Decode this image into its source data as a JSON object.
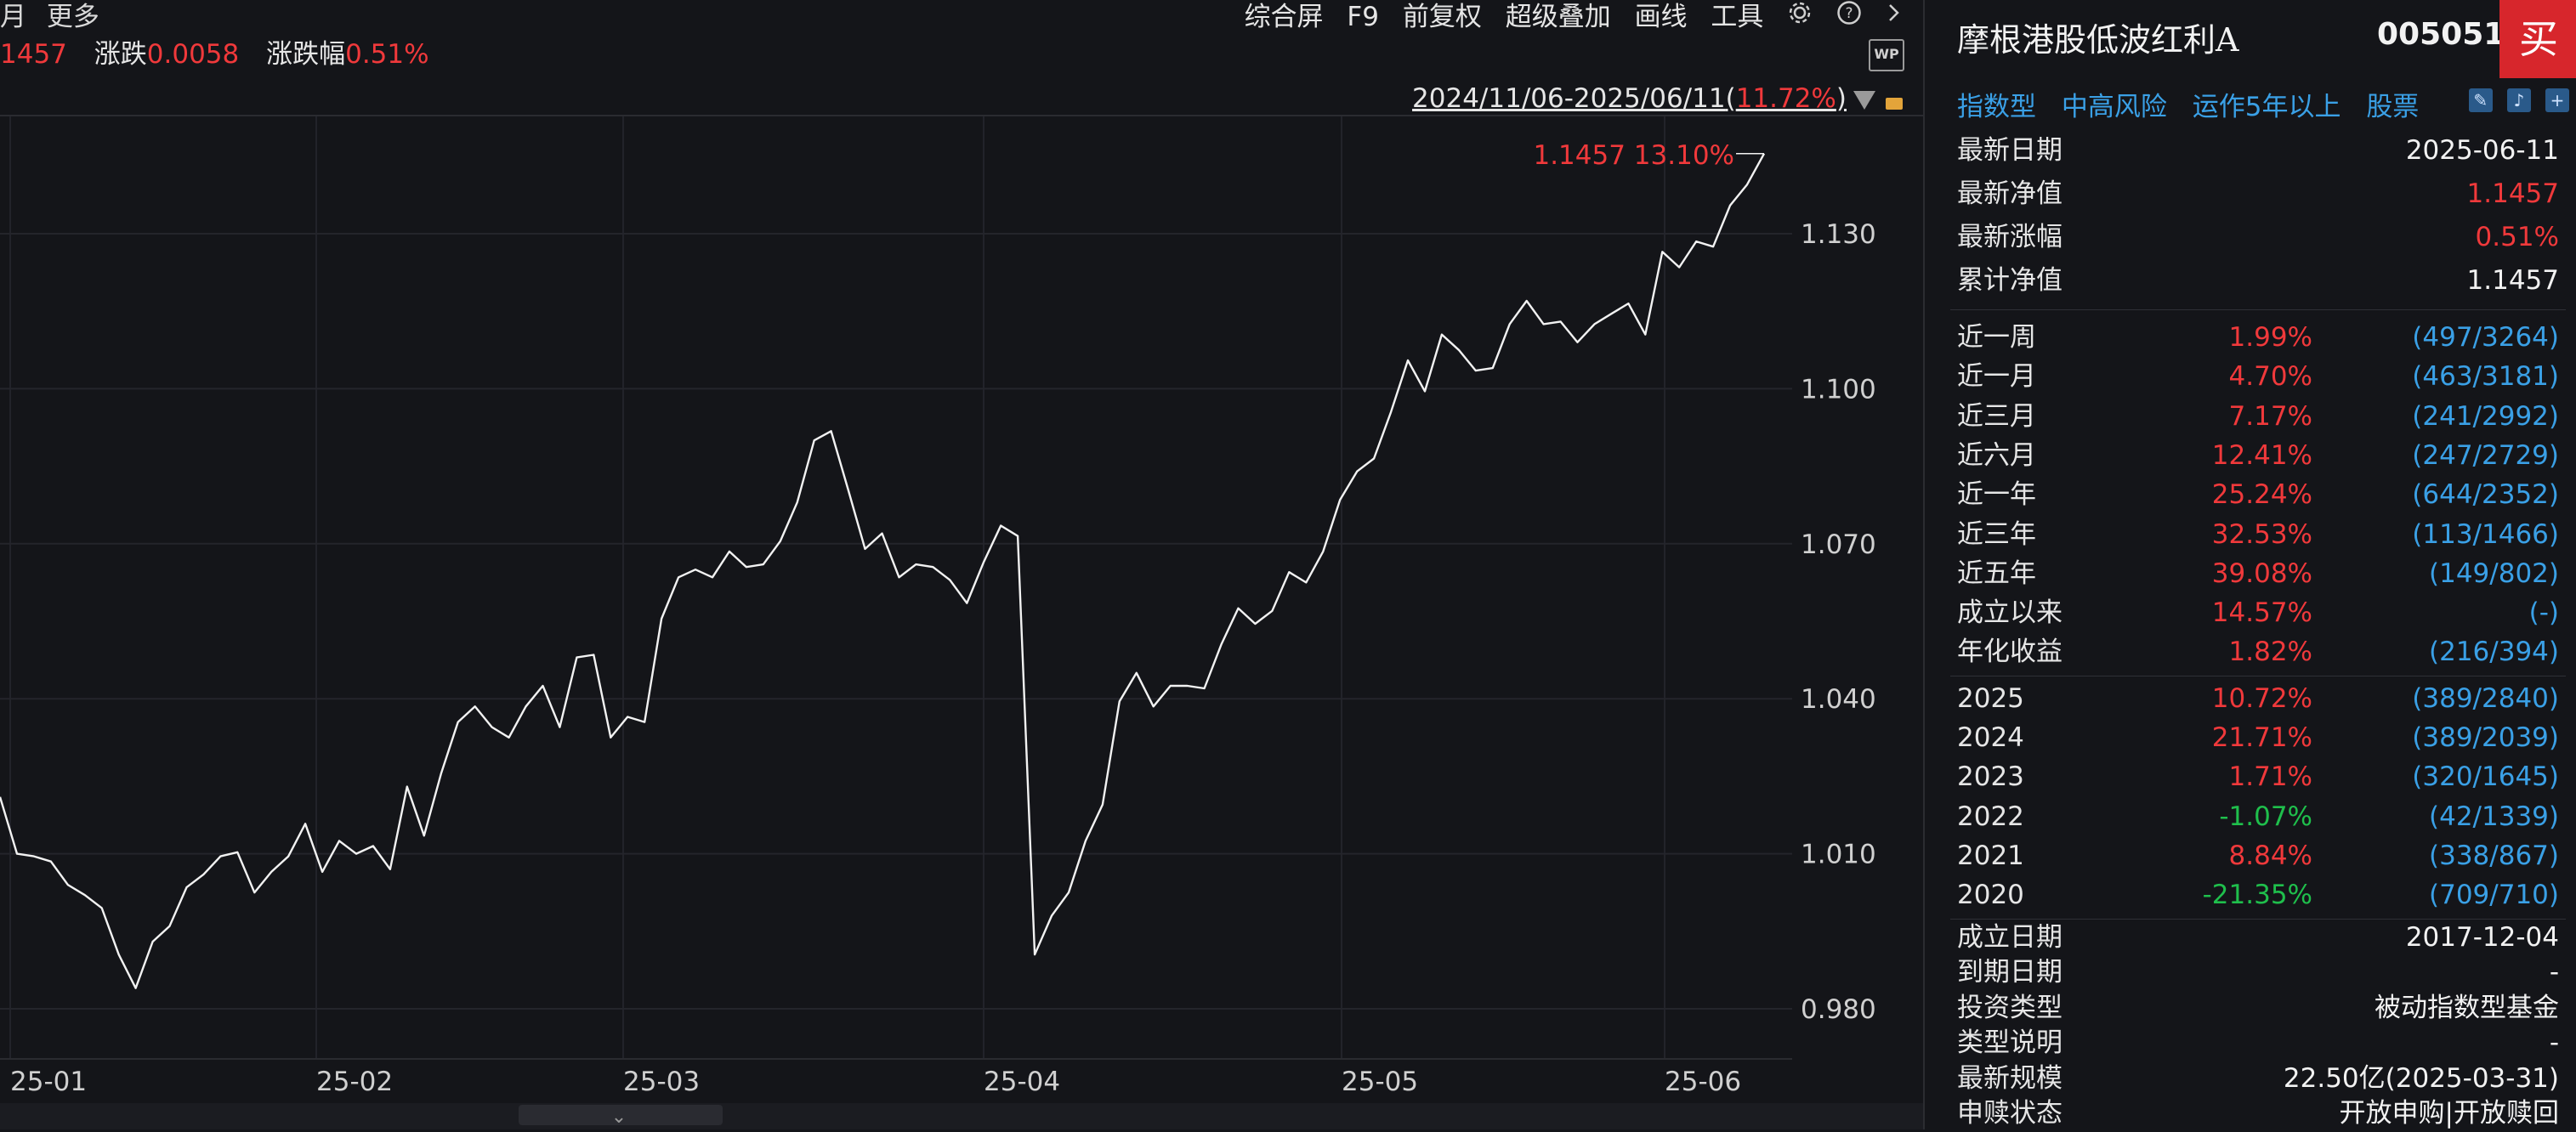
{
  "toolbar": {
    "left": [
      "月",
      "更多"
    ],
    "right": [
      "综合屏",
      "F9",
      "前复权",
      "超级叠加",
      "画线",
      "工具"
    ],
    "settings_icon": "gear-icon",
    "help_icon": "help-icon",
    "next_icon": "chevron-right-icon"
  },
  "quote": {
    "nav_fragment": "1457",
    "change_label": "涨跌",
    "change_value": "0.0058",
    "pct_label": "涨跌幅",
    "pct_value": "0.51%"
  },
  "range": {
    "dates": "2024/11/06-2025/06/11",
    "open_paren": "(",
    "return": "11.72%",
    "close_paren": ")"
  },
  "wp_icon_text": "WP",
  "chart_data": {
    "type": "line",
    "y_ticks": [
      "1.130",
      "1.100",
      "1.070",
      "1.040",
      "1.010",
      "0.980"
    ],
    "y_tick_values": [
      1.13,
      1.1,
      1.07,
      1.04,
      1.01,
      0.98
    ],
    "x_ticks": [
      "25-01",
      "25-02",
      "25-03",
      "25-04",
      "25-05",
      "25-06"
    ],
    "last_label": "1.1457 13.10%",
    "grid": true,
    "series": [
      {
        "values": [
          1.021,
          1.01,
          1.0095,
          1.0085,
          1.004,
          1.002,
          0.9995,
          0.9905,
          0.984,
          0.993,
          0.996,
          1.0035,
          1.006,
          1.0095,
          1.0103,
          1.0025,
          1.0065,
          1.0095,
          1.0158,
          1.0065,
          1.0125,
          1.01,
          1.0115,
          1.007,
          1.023,
          1.0135,
          1.0255,
          1.0355,
          1.0385,
          1.0345,
          1.0325,
          1.0385,
          1.0425,
          1.0345,
          1.048,
          1.0485,
          1.0325,
          1.0365,
          1.0355,
          1.0555,
          1.0635,
          1.065,
          1.0635,
          1.0685,
          1.0655,
          1.066,
          1.0705,
          1.078,
          1.09,
          1.0918,
          1.0805,
          1.069,
          1.072,
          1.0635,
          1.066,
          1.0655,
          1.063,
          1.0585,
          1.0665,
          1.0735,
          1.0715,
          0.9905,
          0.998,
          1.0025,
          1.0125,
          1.0195,
          1.0395,
          1.045,
          1.0385,
          1.0425,
          1.0425,
          1.042,
          1.0505,
          1.0575,
          1.0545,
          1.057,
          1.0645,
          1.0625,
          1.0685,
          1.0785,
          1.084,
          1.0865,
          1.0955,
          1.1055,
          1.0995,
          1.1105,
          1.1075,
          1.1035,
          1.104,
          1.1125,
          1.117,
          1.1125,
          1.113,
          1.109,
          1.1125,
          1.1145,
          1.1165,
          1.1105,
          1.1265,
          1.1235,
          1.1285,
          1.1275,
          1.1355,
          1.1395,
          1.1455
        ]
      }
    ]
  },
  "side": {
    "name": "摩根港股低波红利A",
    "code": "005051",
    "buy": "买",
    "tags": [
      "指数型",
      "中高风险",
      "运作5年以上",
      "股票"
    ],
    "tag_icons": [
      "pencil-icon",
      "bell-icon",
      "plus-icon"
    ],
    "summary": [
      {
        "k": "最新日期",
        "v": "2025-06-11",
        "c": "white"
      },
      {
        "k": "最新净值",
        "v": "1.1457",
        "c": "red"
      },
      {
        "k": "最新涨幅",
        "v": "0.51%",
        "c": "red"
      },
      {
        "k": "累计净值",
        "v": "1.1457",
        "c": "white"
      }
    ],
    "periods": [
      {
        "k": "近一周",
        "p": "1.99%",
        "r": "(497/3264)",
        "c": "red"
      },
      {
        "k": "近一月",
        "p": "4.70%",
        "r": "(463/3181)",
        "c": "red"
      },
      {
        "k": "近三月",
        "p": "7.17%",
        "r": "(241/2992)",
        "c": "red"
      },
      {
        "k": "近六月",
        "p": "12.41%",
        "r": "(247/2729)",
        "c": "red"
      },
      {
        "k": "近一年",
        "p": "25.24%",
        "r": "(644/2352)",
        "c": "red"
      },
      {
        "k": "近三年",
        "p": "32.53%",
        "r": "(113/1466)",
        "c": "red"
      },
      {
        "k": "近五年",
        "p": "39.08%",
        "r": "(149/802)",
        "c": "red"
      },
      {
        "k": "成立以来",
        "p": "14.57%",
        "r": "(-)",
        "c": "red"
      },
      {
        "k": "年化收益",
        "p": "1.82%",
        "r": "(216/394)",
        "c": "red"
      }
    ],
    "years": [
      {
        "k": "2025",
        "p": "10.72%",
        "r": "(389/2840)",
        "c": "red"
      },
      {
        "k": "2024",
        "p": "21.71%",
        "r": "(389/2039)",
        "c": "red"
      },
      {
        "k": "2023",
        "p": "1.71%",
        "r": "(320/1645)",
        "c": "red"
      },
      {
        "k": "2022",
        "p": "-1.07%",
        "r": "(42/1339)",
        "c": "green"
      },
      {
        "k": "2021",
        "p": "8.84%",
        "r": "(338/867)",
        "c": "red"
      },
      {
        "k": "2020",
        "p": "-21.35%",
        "r": "(709/710)",
        "c": "green"
      }
    ],
    "info": [
      {
        "k": "成立日期",
        "v": "2017-12-04"
      },
      {
        "k": "到期日期",
        "v": "-"
      },
      {
        "k": "投资类型",
        "v": "被动指数型基金"
      },
      {
        "k": "类型说明",
        "v": "-"
      },
      {
        "k": "最新规模",
        "v": "22.50亿(2025-03-31)"
      },
      {
        "k": "申赎状态",
        "v": "开放申购|开放赎回"
      }
    ]
  }
}
